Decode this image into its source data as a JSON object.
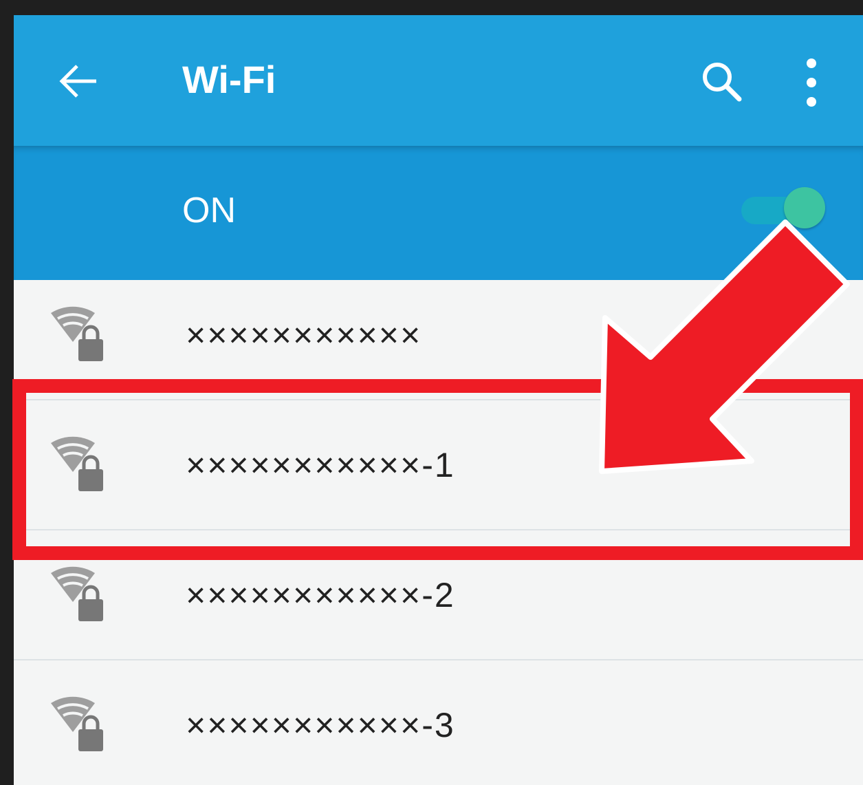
{
  "appbar": {
    "title": "Wi-Fi",
    "back_icon": "arrow-left-icon",
    "search_icon": "search-icon",
    "more_icon": "more-vert-icon"
  },
  "switch": {
    "label": "ON",
    "state": "on"
  },
  "networks": [
    {
      "ssid": "×××××××××××",
      "icon": "wifi-secured-icon"
    },
    {
      "ssid": "×××××××××××-1",
      "icon": "wifi-secured-icon"
    },
    {
      "ssid": "×××××××××××-2",
      "icon": "wifi-secured-icon"
    },
    {
      "ssid": "×××××××××××-3",
      "icon": "wifi-secured-icon"
    }
  ],
  "annotation": {
    "highlighted_item": "×××××××××××-1",
    "color": "#ee1c25"
  },
  "colors": {
    "appbar": "#1fa1dc",
    "switchbar": "#1796d6",
    "background": "#f4f5f5"
  }
}
